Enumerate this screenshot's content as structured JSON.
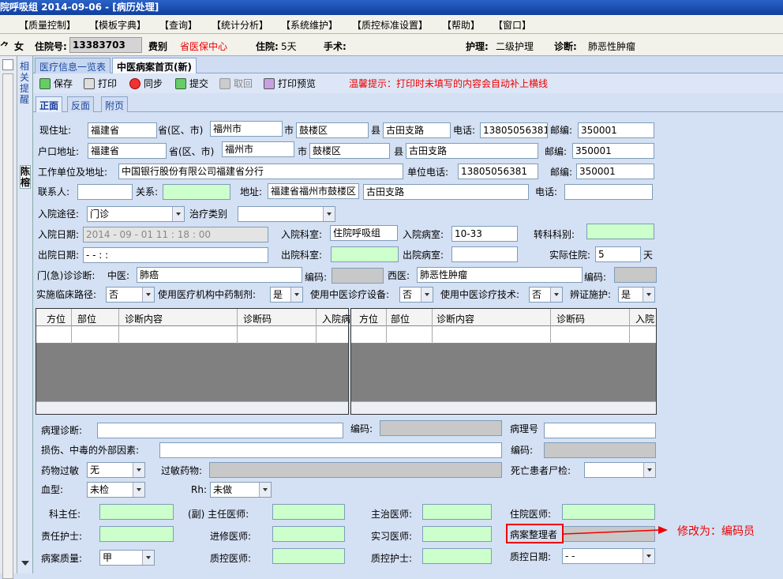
{
  "window": {
    "title": "院呼吸组   2014-09-06 - [病历处理]"
  },
  "menu": [
    "【质量控制】",
    "【模板字典】",
    "【查询】",
    "【统计分析】",
    "【系统维护】",
    "【质控标准设置】",
    "【帮助】",
    "【窗口】"
  ],
  "patient": {
    "gender_partial": "⺈",
    "gender": "女",
    "inpatient_no_label": "住院号:",
    "inpatient_no": "13383703",
    "fee_type_label": "费别",
    "fee_type": "省医保中心",
    "stay_label": "住院:",
    "stay": "5天",
    "surgery_label": "手术:",
    "nursing_label": "护理:",
    "nursing": "二级护理",
    "diagnosis_label": "诊断:",
    "diagnosis": "肺恶性肿瘤"
  },
  "side": {
    "reminder": "相关提醒",
    "name": "陈榕"
  },
  "tabs": [
    "医疗信息一览表",
    "中医病案首页(新)"
  ],
  "toolbar": {
    "save": "保存",
    "print": "打印",
    "sync": "同步",
    "submit": "提交",
    "withdraw": "取回",
    "preview": "打印预览",
    "tip": "温馨提示：打印时未填写的内容会自动补上横线"
  },
  "subtabs": [
    "正面",
    "反面",
    "附页"
  ],
  "address": {
    "label": "现住址:",
    "province": "福建省",
    "province_suffix": "省(区、市)",
    "city": "福州市",
    "city_suffix": "市",
    "county": "鼓楼区",
    "county_suffix": "县",
    "street": "古田支路",
    "phone_label": "电话:",
    "phone": "13805056381",
    "zip_label": "邮编:",
    "zip": "350001"
  },
  "household": {
    "label": "户口地址:",
    "province": "福建省",
    "province_suffix": "省(区、市)",
    "city": "福州市",
    "city_suffix": "市",
    "county": "鼓楼区",
    "county_suffix": "县",
    "street": "古田支路",
    "zip_label": "邮编:",
    "zip": "350001"
  },
  "work": {
    "label": "工作单位及地址:",
    "value": "中国银行股份有限公司福建省分行",
    "phone_label": "单位电话:",
    "phone": "13805056381",
    "zip_label": "邮编:",
    "zip": "350001"
  },
  "contact": {
    "label": "联系人:",
    "relation_label": "关系:",
    "address_label": "地址:",
    "address": "福建省福州市鼓楼区",
    "street": "古田支路",
    "phone_label": "电话:"
  },
  "admission": {
    "route_label": "入院途径:",
    "route": "门诊",
    "treat_label": "治疗类别",
    "date_label": "入院日期:",
    "date": "2014 - 09 - 01   11 : 18 : 00",
    "dept_label": "入院科室:",
    "dept": "住院呼吸组",
    "ward_label": "入院病室:",
    "ward": "10-33",
    "transfer_label": "转科科别:"
  },
  "discharge": {
    "date_label": "出院日期:",
    "date": "-   -        :    :",
    "dept_label": "出院科室:",
    "ward_label": "出院病室:",
    "actual_label": "实际住院:",
    "actual": "5",
    "unit": "天"
  },
  "outpatient": {
    "label": "门(急)诊诊断:",
    "tcm_label": "中医:",
    "tcm": "肺癌",
    "code_label": "编码:",
    "west_label": "西医:",
    "west": "肺恶性肿瘤",
    "code2_label": "编码:"
  },
  "options": {
    "pathway_label": "实施临床路径:",
    "pathway": "否",
    "prep_label": "使用医疗机构中药制剂:",
    "prep": "是",
    "equip_label": "使用中医诊疗设备:",
    "equip": "否",
    "tech_label": "使用中医诊疗技术:",
    "tech": "否",
    "syndrome_label": "辨证施护:",
    "syndrome": "是"
  },
  "grid": {
    "headers": [
      "方位",
      "部位",
      "诊断内容",
      "诊断码",
      "入院病"
    ],
    "headers2": [
      "方位",
      "部位",
      "诊断内容",
      "诊断码",
      "入院"
    ]
  },
  "pathology": {
    "label": "病理诊断:",
    "code_label": "编码:",
    "no_label": "病理号"
  },
  "injury": {
    "label": "损伤、中毒的外部因素:",
    "code_label": "编码:"
  },
  "allergy": {
    "label": "药物过敏",
    "value": "无",
    "drug_label": "过敏药物:",
    "autopsy_label": "死亡患者尸检:"
  },
  "blood": {
    "label": "血型:",
    "value": "未检",
    "rh_label": "Rh:",
    "rh": "未做"
  },
  "doctors": {
    "director": "科主任:",
    "chief": "(副) 主任医师:",
    "attending": "主治医师:",
    "resident": "住院医师:",
    "nurse": "责任护士:",
    "advanced": "进修医师:",
    "intern": "实习医师:",
    "organizer": "病案整理者",
    "quality_label": "病案质量:",
    "quality": "甲",
    "qc_doctor": "质控医师:",
    "qc_nurse": "质控护士:",
    "qc_date_label": "质控日期:",
    "qc_date": "-   -"
  },
  "annotation": "修改为：编码员"
}
